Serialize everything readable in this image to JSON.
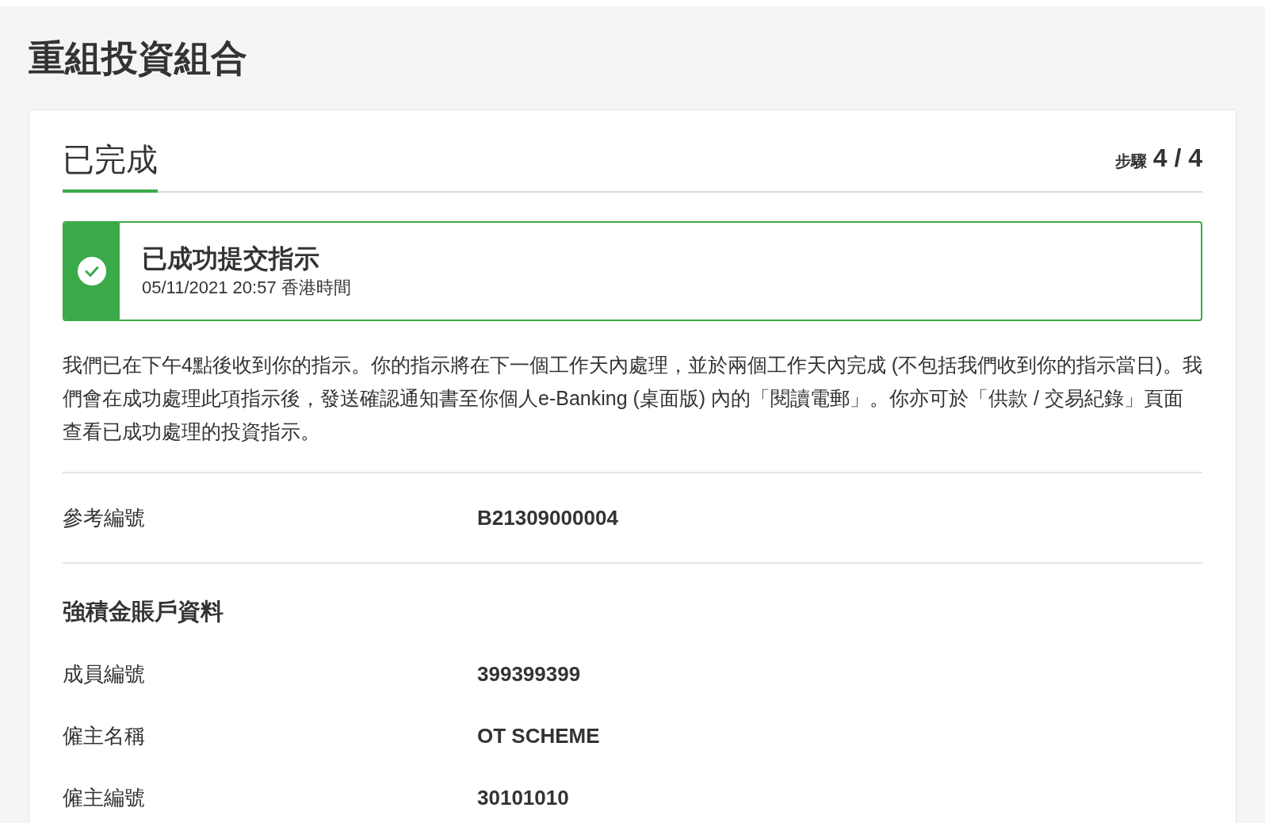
{
  "page_title": "重組投資組合",
  "step": {
    "title": "已完成",
    "label": "步驟",
    "value": "4 / 4"
  },
  "alert": {
    "title": "已成功提交指示",
    "timestamp": "05/11/2021 20:57 香港時間"
  },
  "message": "我們已在下午4點後收到你的指示。你的指示將在下一個工作天內處理，並於兩個工作天內完成 (不包括我們收到你的指示當日)。我們會在成功處理此項指示後，發送確認通知書至你個人e-Banking (桌面版) 內的「閱讀電郵」。你亦可於「供款 / 交易紀錄」頁面查看已成功處理的投資指示。",
  "reference": {
    "label": "參考編號",
    "value": "B21309000004"
  },
  "account": {
    "heading": "強積金賬戶資料",
    "rows": [
      {
        "label": "成員編號",
        "value": "399399399"
      },
      {
        "label": "僱主名稱",
        "value": "OT SCHEME"
      },
      {
        "label": "僱主編號",
        "value": "30101010"
      }
    ]
  }
}
